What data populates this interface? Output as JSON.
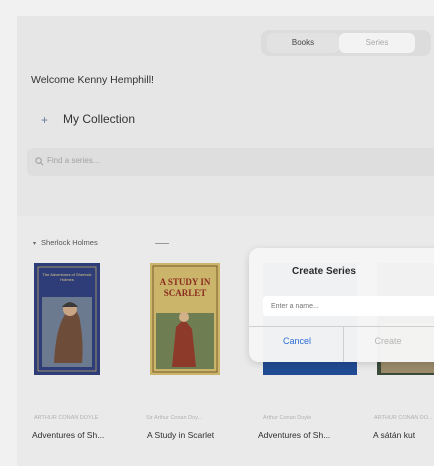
{
  "tabs": {
    "books": "Books",
    "series": "Series"
  },
  "welcome": "Welcome Kenny Hemphill!",
  "collection": {
    "label": "My Collection",
    "plus": "+"
  },
  "search": {
    "placeholder": "Find a series..."
  },
  "series": {
    "name": "Sherlock Holmes",
    "chevron": "▾"
  },
  "books": [
    {
      "author": "ARTHUR CONAN DOYLE",
      "title": "Adventures of Sh...",
      "cover_color": "#2f3f7e"
    },
    {
      "author": "Sir Arthur Conan Doy...",
      "title": "A Study in Scarlet",
      "cover_color": "#c9b46a"
    },
    {
      "author": "Arthur Conan Doyle",
      "title": "Adventures of Sh...",
      "cover_color": "#204a8f"
    },
    {
      "author": "ARTHUR CONAN DO...",
      "title": "A sátán kut",
      "cover_color": "#3b4a3a"
    }
  ],
  "cover_texts": {
    "book1_top": "The Adventures of Sherlock Holmes",
    "book2_top": "A STUDY IN SCARLET"
  },
  "dialog": {
    "title": "Create Series",
    "input_placeholder": "Enter a name...",
    "cancel": "Cancel",
    "create": "Create"
  }
}
